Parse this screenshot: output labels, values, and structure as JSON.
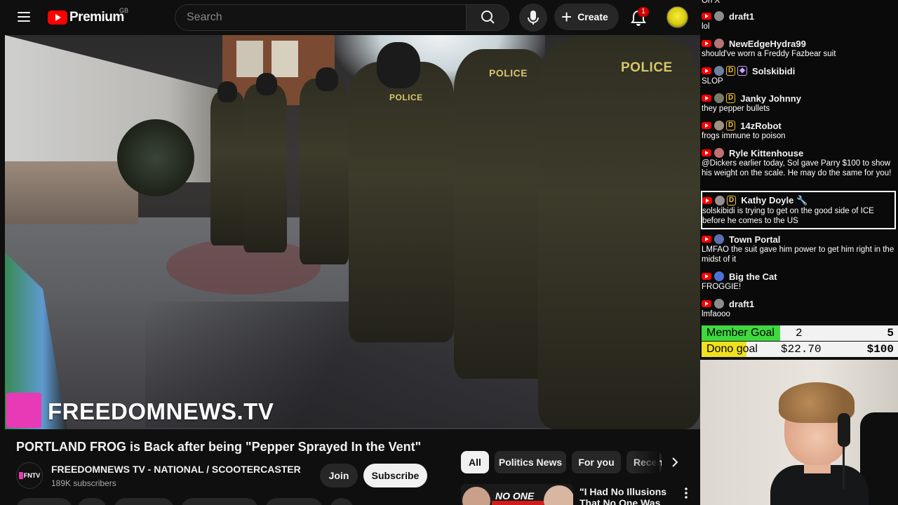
{
  "topbar": {
    "logo_text": "Premium",
    "country_code": "GB",
    "search_placeholder": "Search",
    "create_label": "Create",
    "notification_count": "1"
  },
  "video": {
    "watermark": "FREEDOMNEWS.TV",
    "police_labels": [
      "POLICE",
      "POLICE",
      "POLICE"
    ]
  },
  "info": {
    "title": "PORTLAND FROG is Back after being \"Pepper Sprayed In the Vent\"",
    "channel_avatar_text": "FNTV",
    "channel_name": "FREEDOMNEWS TV - NATIONAL / SCOOTERCASTER",
    "subscribers": "189K subscribers",
    "join_label": "Join",
    "subscribe_label": "Subscribe"
  },
  "chips": [
    "All",
    "Politics News",
    "For you",
    "Recently uploaded"
  ],
  "recommendation": {
    "thumb_text": "NO ONE",
    "title": "\"I Had No Illusions That No One Was"
  },
  "chat": {
    "top_partial": "On X",
    "messages": [
      {
        "name": "draft1",
        "text": "lol"
      },
      {
        "name": "NewEdgeHydra99",
        "text": "should've worn a Freddy Fazbear suit"
      },
      {
        "name": "Solskibidi",
        "text": "SLOP"
      },
      {
        "name": "Janky Johnny",
        "text": "they pepper bullets"
      },
      {
        "name": "14zRobot",
        "text": "frogs immune to poison"
      },
      {
        "name": "Ryle Kittenhouse",
        "text": "@Dickers earlier today, Sol gave Parry $100 to show his weight on the scale. He may do the same for you!"
      },
      {
        "name": "Kathy Doyle 🔧",
        "text": "solskibidi is trying to get on the good side of ICE before he comes to the US"
      },
      {
        "name": "Town Portal",
        "text": "LMFAO the suit gave him power to get him right in the midst of it"
      },
      {
        "name": "Big the Cat",
        "text": "FROGGIE!"
      },
      {
        "name": "draft1",
        "text": "lmfaooo"
      }
    ]
  },
  "goals": {
    "member": {
      "label": "Member Goal",
      "current": "2",
      "target": "5",
      "progress": 0.4,
      "color": "#3fd93f"
    },
    "dono": {
      "label": "Dono goal",
      "current": "$22.70",
      "target": "$100",
      "progress": 0.227,
      "color": "#f0e020"
    }
  }
}
